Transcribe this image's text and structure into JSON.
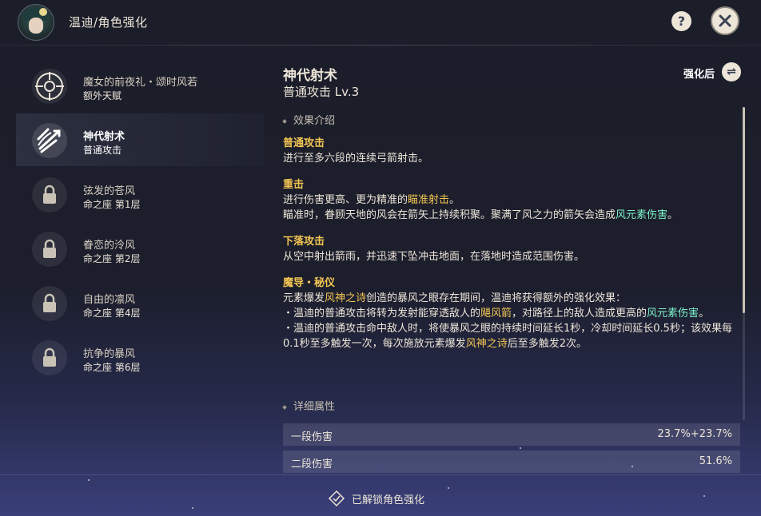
{
  "header": {
    "title": "温迪/角色强化",
    "help_icon": "question-icon",
    "close_icon": "close-icon"
  },
  "sidebar": {
    "items": [
      {
        "name": "魔女的前夜礼・颂时风若",
        "sub": "额外天赋",
        "icon": "talent-icon",
        "locked": false
      },
      {
        "name": "神代射术",
        "sub": "普通攻击",
        "icon": "bow-arrows-icon",
        "locked": false,
        "active": true
      },
      {
        "name": "弦发的苍风",
        "sub": "命之座 第1层",
        "icon": "lock-icon",
        "locked": true
      },
      {
        "name": "眷恋的泠风",
        "sub": "命之座 第2层",
        "icon": "lock-icon",
        "locked": true
      },
      {
        "name": "自由的凛风",
        "sub": "命之座 第4层",
        "icon": "lock-icon",
        "locked": true
      },
      {
        "name": "抗争的暴风",
        "sub": "命之座 第6层",
        "icon": "lock-icon",
        "locked": true
      }
    ]
  },
  "content": {
    "skill_name": "神代射术",
    "skill_level": "普通攻击 Lv.3",
    "enhance_label": "强化后",
    "swap_icon": "swap-icon",
    "effect_heading": "效果介绍",
    "detail_heading": "详细属性",
    "sections": [
      {
        "title": "普通攻击",
        "lines": [
          "进行至多六段的连续弓箭射击。"
        ]
      },
      {
        "title": "重击",
        "lines": [
          "进行伤害更高、更为精准的",
          "瞄准射击",
          "。",
          "瞄准时，眷顾天地的风会在箭矢上持续积聚。聚满了风之力的箭矢会造成",
          "风元素伤害",
          "。"
        ]
      },
      {
        "title": "下落攻击",
        "lines": [
          "从空中射出箭雨，并迅速下坠冲击地面，在落地时造成范围伤害。"
        ]
      },
      {
        "title": "魔导・秘仪",
        "lines": [
          "元素爆发",
          "风神之诗",
          "创造的暴风之眼存在期间，温迪将获得额外的强化效果：",
          "・温迪的普通攻击将转为发射能穿透敌人的",
          "飓风箭",
          "，对路径上的敌人造成更高的",
          "风元素伤害",
          "。",
          "・温迪的普通攻击命中敌人时，将使暴风之眼的持续时间延长1秒，冷却时间延长0.5秒；该效果每0.1秒至多触发一次，每次施放元素爆发",
          "风神之诗",
          "后至多触发2次。"
        ]
      }
    ],
    "attributes": [
      {
        "key": "一段伤害",
        "value": "23.7%+23.7%"
      },
      {
        "key": "二段伤害",
        "value": "51.6%"
      }
    ]
  },
  "footer": {
    "unlock_text": "已解锁角色强化",
    "unlock_icon": "unlocked-diamond-icon"
  },
  "colors": {
    "accent_yellow": "#f2c553",
    "accent_green": "#7ef2c8",
    "text": "#ece5d8"
  }
}
